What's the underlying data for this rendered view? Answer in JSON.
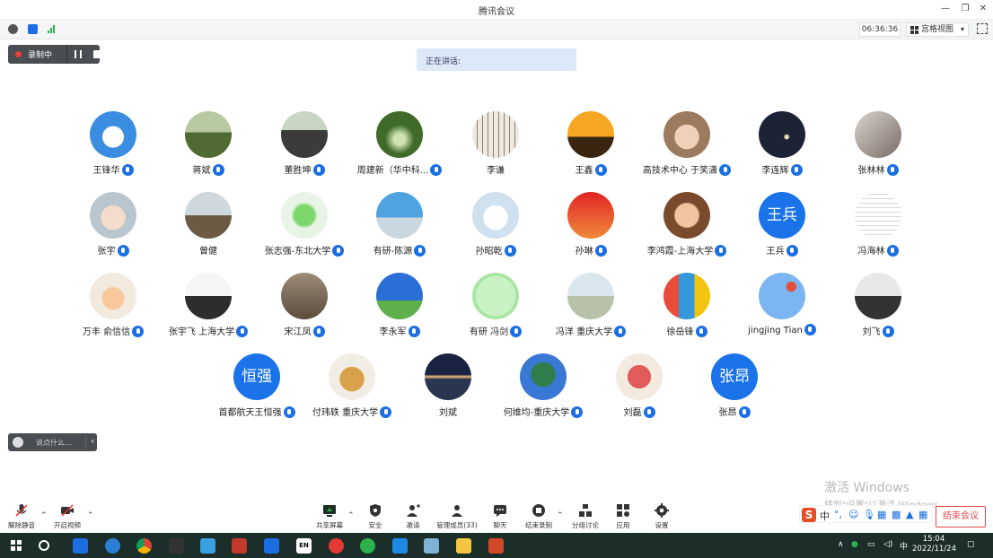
{
  "window": {
    "title": "腾讯会议"
  },
  "toolbar_top": {
    "timer": "06:36:36",
    "view_mode": "宫格视图"
  },
  "recording": {
    "label": "录制中"
  },
  "speaking": {
    "label": "正在讲话:"
  },
  "participants": [
    {
      "name": "王锋华",
      "avatar": "dove"
    },
    {
      "name": "蒋斌",
      "avatar": "tree"
    },
    {
      "name": "董胜坤",
      "avatar": "man"
    },
    {
      "name": "周建新（华中科...",
      "avatar": "forest"
    },
    {
      "name": "李谦",
      "avatar": "calligraphy",
      "no_mic": true
    },
    {
      "name": "王鑫",
      "avatar": "sunset-horse"
    },
    {
      "name": "高技术中心 于笑潇",
      "avatar": "child"
    },
    {
      "name": "李连辉",
      "avatar": "night"
    },
    {
      "name": "张林林",
      "avatar": "gray-photo"
    },
    {
      "name": "张宇",
      "avatar": "baby"
    },
    {
      "name": "曾健",
      "avatar": "house",
      "no_mic": true
    },
    {
      "name": "张志强-东北大学",
      "avatar": "clover"
    },
    {
      "name": "有研-陈源",
      "avatar": "sky-person"
    },
    {
      "name": "孙昭乾",
      "avatar": "cartoon"
    },
    {
      "name": "孙琳",
      "avatar": "red-sky"
    },
    {
      "name": "李鸿霞-上海大学",
      "avatar": "pig"
    },
    {
      "name": "王兵",
      "avatar_text": "王兵"
    },
    {
      "name": "冯海林",
      "avatar": "text-image"
    },
    {
      "name": "万丰 俞信信",
      "avatar": "bunny"
    },
    {
      "name": "张宇飞 上海大学",
      "avatar": "snowman"
    },
    {
      "name": "宋江凤",
      "avatar": "elephant"
    },
    {
      "name": "李永军",
      "avatar": "blue-sky"
    },
    {
      "name": "有研 冯剑",
      "avatar": "face"
    },
    {
      "name": "冯洋 重庆大学",
      "avatar": "beach"
    },
    {
      "name": "徐岳锋",
      "avatar": "kid-colorful"
    },
    {
      "name": "jingjing Tian",
      "avatar": "balloons"
    },
    {
      "name": "刘飞",
      "avatar": "bw-couple"
    },
    {
      "name": "首都航天王恒强",
      "avatar_text": "恒强"
    },
    {
      "name": "付玮轶 重庆大学",
      "avatar": "dog"
    },
    {
      "name": "刘斌",
      "avatar": "sea-sunset",
      "no_mic": true
    },
    {
      "name": "何维均-重庆大学",
      "avatar": "palm"
    },
    {
      "name": "刘磊",
      "avatar": "weave"
    },
    {
      "name": "张昂",
      "avatar_text": "张昂"
    }
  ],
  "chat": {
    "placeholder": "说点什么..."
  },
  "bottom_toolbar": {
    "unmute": "解除静音",
    "start_video": "开启视频",
    "share_screen": "共享屏幕",
    "security": "安全",
    "invite": "邀请",
    "manage_members": "管理成员(33)",
    "chat": "聊天",
    "end_recording": "结束录制",
    "breakout": "分组讨论",
    "apps": "应用",
    "settings": "设置",
    "end_meeting": "结束会议"
  },
  "watermark": {
    "line1": "激活 Windows",
    "line2": "转到\"设置\"以激活 Windows。"
  },
  "ime": {
    "lang": "中"
  },
  "taskbar": {
    "time": "15:04",
    "date": "2022/11/24",
    "tray_lang": "中",
    "en_badge": "EN"
  }
}
